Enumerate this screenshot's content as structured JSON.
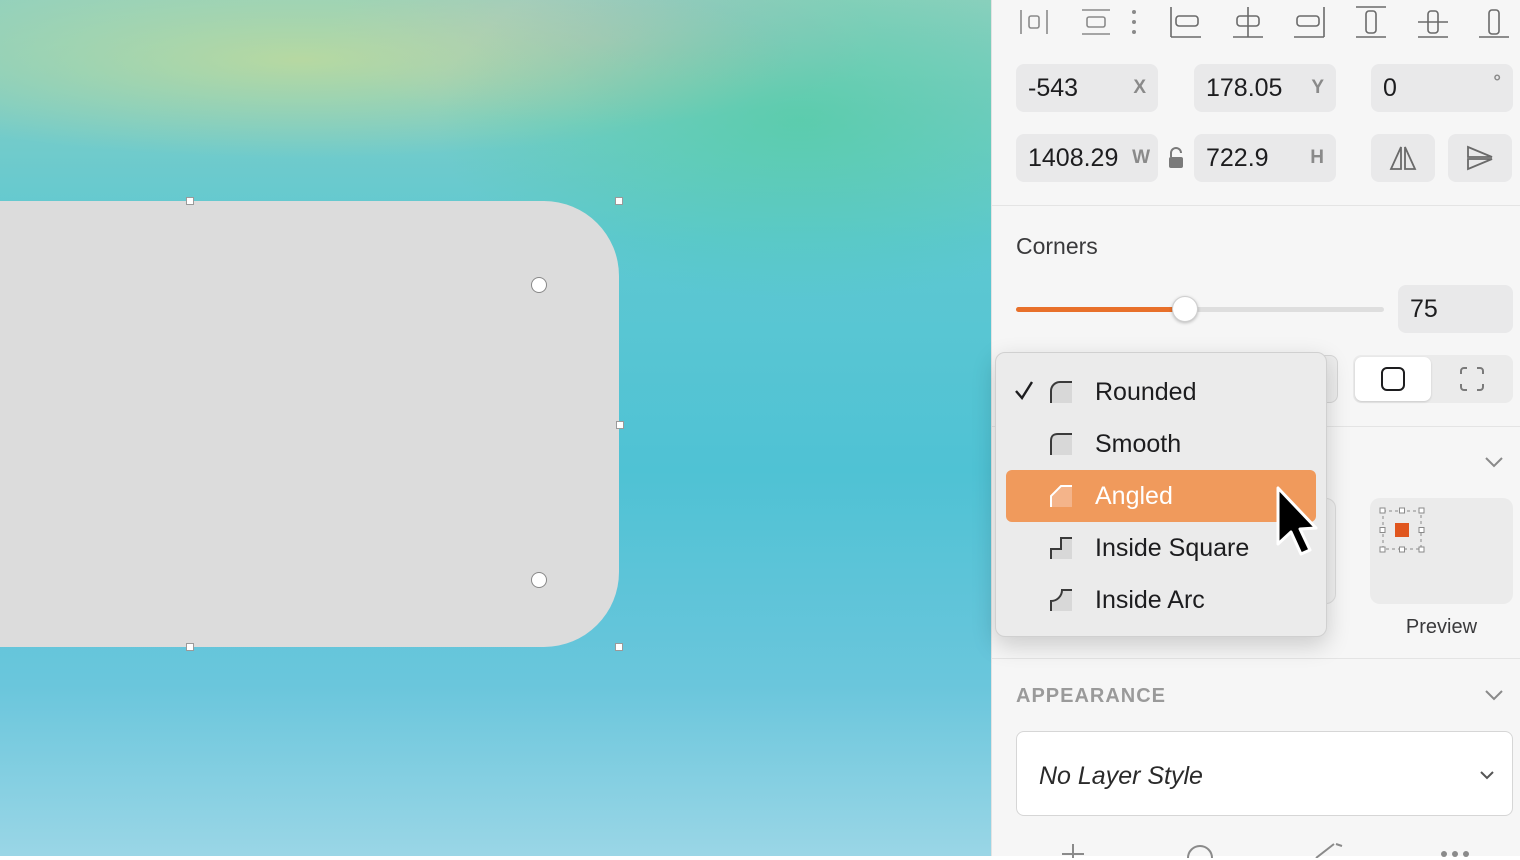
{
  "toolbar": {
    "icons": [
      "distribute-horizontal-icon",
      "distribute-vertical-icon",
      "more-vertical-icon",
      "align-left-icon",
      "align-center-icon",
      "align-right-icon",
      "align-top-icon",
      "align-middle-icon",
      "align-bottom-icon"
    ]
  },
  "geometry": {
    "x": {
      "value": "-543",
      "label": "X"
    },
    "y": {
      "value": "178.05",
      "label": "Y"
    },
    "rotation": {
      "value": "0",
      "label": "°"
    },
    "w": {
      "value": "1408.29",
      "label": "W"
    },
    "h": {
      "value": "722.9",
      "label": "H"
    }
  },
  "corners": {
    "title": "Corners",
    "value": "75",
    "slider_fraction": 0.46
  },
  "corner_menu": {
    "items": [
      {
        "label": "Rounded",
        "checked": true,
        "selected": false
      },
      {
        "label": "Smooth",
        "checked": false,
        "selected": false
      },
      {
        "label": "Angled",
        "checked": false,
        "selected": true
      },
      {
        "label": "Inside Square",
        "checked": false,
        "selected": false
      },
      {
        "label": "Inside Arc",
        "checked": false,
        "selected": false
      }
    ]
  },
  "preview": {
    "label": "Preview"
  },
  "appearance": {
    "title": "APPEARANCE",
    "layer_style": "No Layer Style"
  },
  "colors": {
    "accent": "#e8702a",
    "menu_highlight": "#f09a5c",
    "panel_bg": "#f6f6f6",
    "shape_fill": "#dcdcdc"
  }
}
